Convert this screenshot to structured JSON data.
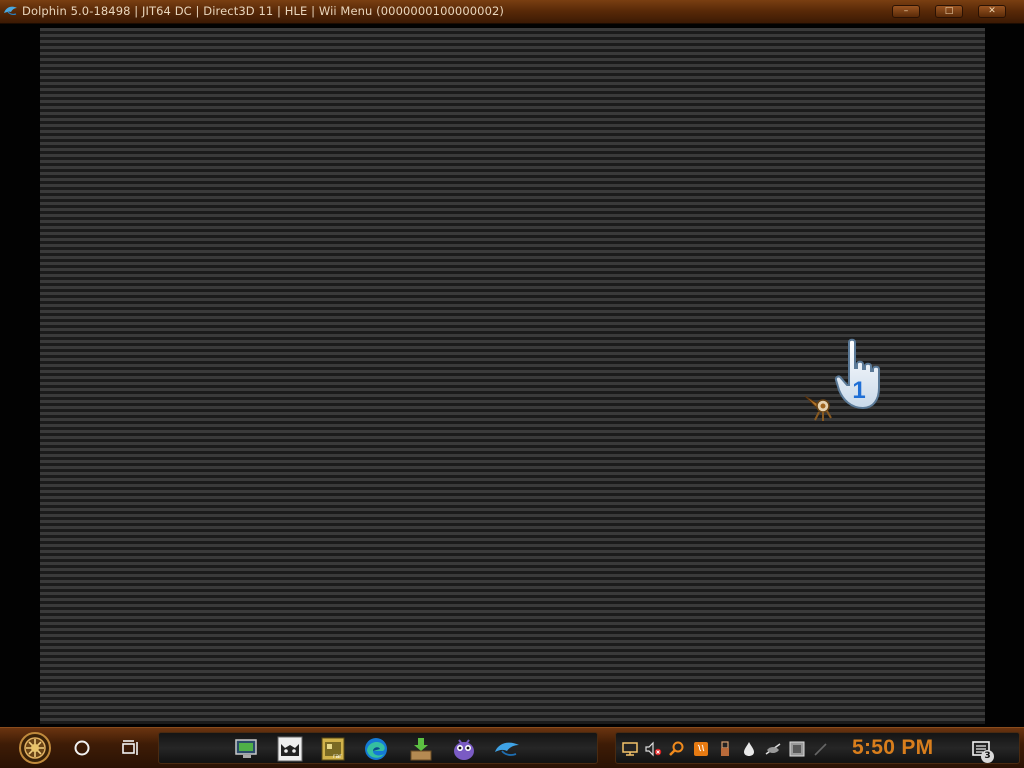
{
  "window": {
    "title": "Dolphin 5.0-18498 | JIT64 DC | Direct3D 11 | HLE | Wii Menu (0000000100000002)",
    "icon": "dolphin-icon",
    "controls": {
      "minimize_icon": "minimize-icon",
      "maximize_icon": "maximize-icon",
      "close_icon": "close-icon"
    }
  },
  "emulation": {
    "pointer_number": "1"
  },
  "taskbar": {
    "start_icon": "steampunk-gear-start-icon",
    "search_icon": "search-circle-icon",
    "task_view_icon": "task-view-icon",
    "pinned_apps": [
      {
        "name": "computer-monitor-app-icon"
      },
      {
        "name": "cat-app-icon"
      },
      {
        "name": "winrar-app-icon"
      },
      {
        "name": "edge-browser-icon"
      },
      {
        "name": "download-box-app-icon"
      },
      {
        "name": "purple-creature-app-icon"
      },
      {
        "name": "dolphin-app-icon"
      }
    ],
    "tray_icons": [
      {
        "name": "network-icon"
      },
      {
        "name": "volume-muted-icon"
      },
      {
        "name": "search-magnifier-icon"
      },
      {
        "name": "java-icon"
      },
      {
        "name": "usb-icon"
      },
      {
        "name": "drop-icon"
      },
      {
        "name": "hidden-icons-icon"
      },
      {
        "name": "display-icon"
      },
      {
        "name": "pen-icon"
      }
    ],
    "clock": "5:50 PM",
    "notifications_count": "3",
    "accent_color": "#d97e1c"
  }
}
